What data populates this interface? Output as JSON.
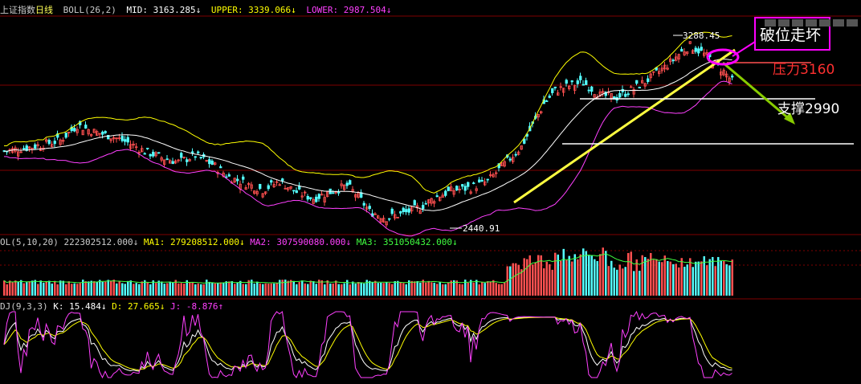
{
  "header": {
    "index_name": "上证指数",
    "period": "日线",
    "indicator": "BOLL(26,2)",
    "mid": "MID: 3163.285↓",
    "upper": "UPPER: 3339.066↓",
    "lower": "LOWER: 2987.504↓"
  },
  "volume_header": {
    "label": "OL(5,10,20)",
    "vol": "222302512.000↓",
    "ma1": "MA1: 279208512.000↓",
    "ma2": "MA2: 307590080.000↓",
    "ma3": "MA3: 351050432.000↓"
  },
  "kdj_header": {
    "label": "DJ(9,3,3)",
    "k": "K: 15.484↓",
    "d": "D: 27.665↓",
    "j": "J: -8.876↑"
  },
  "annotations": {
    "high_label": "3288.45",
    "low_label": "2440.91",
    "breakdown": "破位走坏",
    "resistance": "压力3160",
    "support": "支撑2990"
  },
  "colors": {
    "up": "#ff5050",
    "down": "#54ffff",
    "mid": "#ffffff",
    "upper": "#ffff00",
    "lower": "#ff40ff",
    "trend": "#ffff40",
    "arrow_green": "#88cc00",
    "box": "#ff00ff",
    "resistance_text": "#ff3030",
    "grid": "#800000"
  },
  "chart_data": {
    "type": "candlestick",
    "y_range": [
      2400,
      3340
    ],
    "key_levels": {
      "high": 3288.45,
      "low": 2440.91,
      "resistance": 3160,
      "support": 2990
    },
    "close_path": [
      [
        0,
        2780
      ],
      [
        10,
        2800
      ],
      [
        20,
        2830
      ],
      [
        26,
        2900
      ],
      [
        32,
        2870
      ],
      [
        38,
        2850
      ],
      [
        44,
        2820
      ],
      [
        50,
        2780
      ],
      [
        56,
        2750
      ],
      [
        62,
        2730
      ],
      [
        68,
        2760
      ],
      [
        74,
        2720
      ],
      [
        80,
        2660
      ],
      [
        86,
        2630
      ],
      [
        92,
        2600
      ],
      [
        98,
        2640
      ],
      [
        104,
        2590
      ],
      [
        110,
        2560
      ],
      [
        116,
        2590
      ],
      [
        122,
        2620
      ],
      [
        126,
        2570
      ],
      [
        130,
        2500
      ],
      [
        136,
        2470
      ],
      [
        142,
        2490
      ],
      [
        148,
        2520
      ],
      [
        154,
        2570
      ],
      [
        160,
        2600
      ],
      [
        166,
        2610
      ],
      [
        172,
        2640
      ],
      [
        178,
        2720
      ],
      [
        184,
        2800
      ],
      [
        188,
        2900
      ],
      [
        192,
        3000
      ],
      [
        196,
        3060
      ],
      [
        200,
        3080
      ],
      [
        206,
        3100
      ],
      [
        212,
        3040
      ],
      [
        218,
        3030
      ],
      [
        224,
        3070
      ],
      [
        230,
        3120
      ],
      [
        236,
        3180
      ],
      [
        240,
        3230
      ],
      [
        244,
        3270
      ],
      [
        248,
        3240
      ],
      [
        252,
        3200
      ],
      [
        256,
        3150
      ],
      [
        260,
        3090
      ]
    ]
  }
}
